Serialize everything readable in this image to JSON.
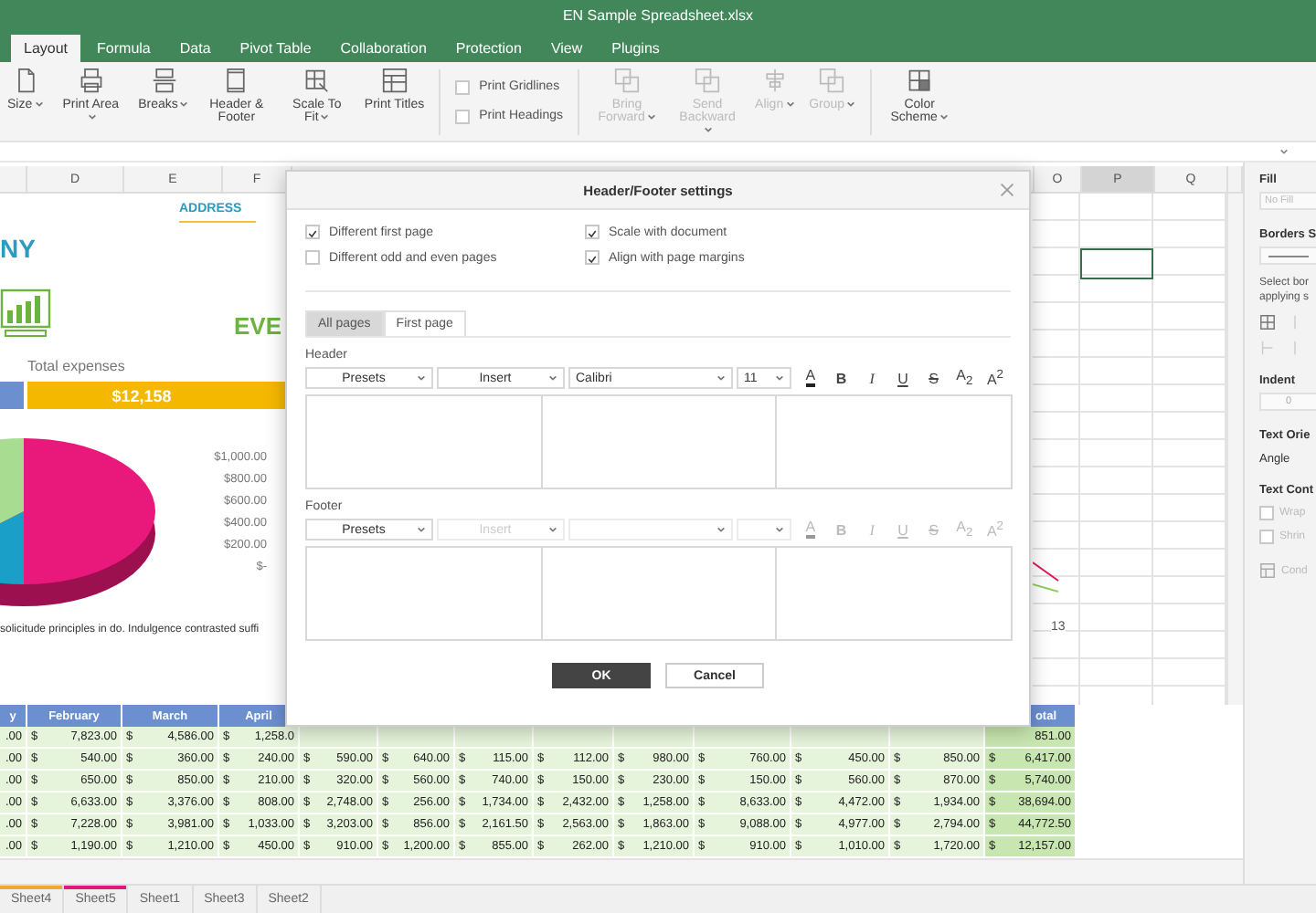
{
  "window": {
    "title": "EN Sample Spreadsheet.xlsx"
  },
  "tabs": [
    {
      "label": "Layout",
      "selected": true
    },
    {
      "label": "Formula",
      "selected": false
    },
    {
      "label": "Data",
      "selected": false
    },
    {
      "label": "Pivot Table",
      "selected": false
    },
    {
      "label": "Collaboration",
      "selected": false
    },
    {
      "label": "Protection",
      "selected": false
    },
    {
      "label": "View",
      "selected": false
    },
    {
      "label": "Plugins",
      "selected": false
    }
  ],
  "toolbar": {
    "page_buttons": [
      {
        "kind": "size",
        "label": "Size",
        "dropdown": true,
        "disabled": false
      },
      {
        "kind": "print-area",
        "label": "Print Area",
        "dropdown": true,
        "disabled": false
      },
      {
        "kind": "breaks",
        "label": "Breaks",
        "dropdown": true,
        "disabled": false
      },
      {
        "kind": "header-footer",
        "label": "Header & Footer",
        "dropdown": false,
        "disabled": false
      },
      {
        "kind": "scale",
        "label": "Scale To Fit",
        "dropdown": true,
        "disabled": false
      },
      {
        "kind": "print-titles",
        "label": "Print Titles",
        "dropdown": false,
        "disabled": false
      }
    ],
    "checkboxes": [
      {
        "label": "Print Gridlines",
        "checked": false
      },
      {
        "label": "Print Headings",
        "checked": false
      }
    ],
    "arrange_buttons": [
      {
        "kind": "bring-forward",
        "label": "Bring Forward",
        "dropdown": true,
        "disabled": true
      },
      {
        "kind": "send-backward",
        "label": "Send Backward",
        "dropdown": true,
        "disabled": true
      },
      {
        "kind": "align",
        "label": "Align",
        "dropdown": true,
        "disabled": true
      },
      {
        "kind": "group",
        "label": "Group",
        "dropdown": true,
        "disabled": true
      }
    ],
    "scheme_buttons": [
      {
        "kind": "color-scheme",
        "label": "Color Scheme",
        "dropdown": true,
        "disabled": false
      }
    ]
  },
  "sheet": {
    "columns_left": [
      {
        "label": "D",
        "selected": false
      },
      {
        "label": "E",
        "selected": false
      },
      {
        "label": "F",
        "selected": false
      }
    ],
    "columns_right": [
      {
        "label": "O",
        "selected": false
      },
      {
        "label": "P",
        "selected": true
      },
      {
        "label": "Q",
        "selected": false
      }
    ],
    "address_label": "ADDRESS",
    "company_fragment": "NY",
    "events_fragment": "EVE",
    "expenses_label": "Total expenses",
    "expenses_value": "$12,158",
    "axis_labels": [
      "$1,000.00",
      "$800.00",
      "$600.00",
      "$400.00",
      "$200.00",
      "$-"
    ],
    "note": "solicitude principles in do. Indulgence contrasted suffi",
    "chart_label": "13"
  },
  "table": {
    "headers": [
      "y",
      "February",
      "March",
      "April"
    ],
    "total_header": "otal",
    "rows": [
      [
        [
          ".00"
        ],
        [
          "$",
          "7,823.00"
        ],
        [
          "$",
          "4,586.00"
        ],
        [
          "$",
          "1,258.0"
        ],
        null,
        null,
        null,
        null,
        null,
        null,
        null,
        null,
        [
          "851.00"
        ]
      ],
      [
        [
          ".00"
        ],
        [
          "$",
          "540.00"
        ],
        [
          "$",
          "360.00"
        ],
        [
          "$",
          "240.00"
        ],
        [
          "$",
          "590.00"
        ],
        [
          "$",
          "640.00"
        ],
        [
          "$",
          "115.00"
        ],
        [
          "$",
          "112.00"
        ],
        [
          "$",
          "980.00"
        ],
        [
          "$",
          "760.00"
        ],
        [
          "$",
          "450.00"
        ],
        [
          "$",
          "850.00"
        ],
        [
          "$",
          "6,417.00"
        ]
      ],
      [
        [
          ".00"
        ],
        [
          "$",
          "650.00"
        ],
        [
          "$",
          "850.00"
        ],
        [
          "$",
          "210.00"
        ],
        [
          "$",
          "320.00"
        ],
        [
          "$",
          "560.00"
        ],
        [
          "$",
          "740.00"
        ],
        [
          "$",
          "150.00"
        ],
        [
          "$",
          "230.00"
        ],
        [
          "$",
          "150.00"
        ],
        [
          "$",
          "560.00"
        ],
        [
          "$",
          "870.00"
        ],
        [
          "$",
          "5,740.00"
        ]
      ],
      [
        [
          ".00"
        ],
        [
          "$",
          "6,633.00"
        ],
        [
          "$",
          "3,376.00"
        ],
        [
          "$",
          "808.00"
        ],
        [
          "$",
          "2,748.00"
        ],
        [
          "$",
          "256.00"
        ],
        [
          "$",
          "1,734.00"
        ],
        [
          "$",
          "2,432.00"
        ],
        [
          "$",
          "1,258.00"
        ],
        [
          "$",
          "8,633.00"
        ],
        [
          "$",
          "4,472.00"
        ],
        [
          "$",
          "1,934.00"
        ],
        [
          "$",
          "38,694.00"
        ]
      ],
      [
        [
          ".00"
        ],
        [
          "$",
          "7,228.00"
        ],
        [
          "$",
          "3,981.00"
        ],
        [
          "$",
          "1,033.00"
        ],
        [
          "$",
          "3,203.00"
        ],
        [
          "$",
          "856.00"
        ],
        [
          "$",
          "2,161.50"
        ],
        [
          "$",
          "2,563.00"
        ],
        [
          "$",
          "1,863.00"
        ],
        [
          "$",
          "9,088.00"
        ],
        [
          "$",
          "4,977.00"
        ],
        [
          "$",
          "2,794.00"
        ],
        [
          "$",
          "44,772.50"
        ]
      ],
      [
        [
          ".00"
        ],
        [
          "$",
          "1,190.00"
        ],
        [
          "$",
          "1,210.00"
        ],
        [
          "$",
          "450.00"
        ],
        [
          "$",
          "910.00"
        ],
        [
          "$",
          "1,200.00"
        ],
        [
          "$",
          "855.00"
        ],
        [
          "$",
          "262.00"
        ],
        [
          "$",
          "1,210.00"
        ],
        [
          "$",
          "910.00"
        ],
        [
          "$",
          "1,010.00"
        ],
        [
          "$",
          "1,720.00"
        ],
        [
          "$",
          "12,157.00"
        ]
      ]
    ]
  },
  "sheet_tabs": [
    {
      "label": "Sheet4",
      "color": "#f0a830"
    },
    {
      "label": "Sheet5",
      "color": "#e0197a"
    },
    {
      "label": "Sheet1"
    },
    {
      "label": "Sheet3"
    },
    {
      "label": "Sheet2"
    }
  ],
  "panel": {
    "fill_label": "Fill",
    "fill_placeholder": "No Fill",
    "borders_label": "Borders S",
    "borders_hint": [
      "Select bor",
      "applying s"
    ],
    "indent_label": "Indent",
    "indent_value": "0",
    "orientation_label": "Text Orie",
    "angle_label": "Angle",
    "control_label": "Text Cont",
    "options": [
      {
        "label": "Wrap",
        "checked": false,
        "disabled": true
      },
      {
        "label": "Shrin",
        "checked": false,
        "disabled": true
      }
    ],
    "conditional": {
      "label": "Cond",
      "disabled": true
    }
  },
  "dialog": {
    "title": "Header/Footer settings",
    "options": [
      {
        "label": "Different first page",
        "checked": true
      },
      {
        "label": "Scale with document",
        "checked": true
      },
      {
        "label": "Different odd and even pages",
        "checked": false
      },
      {
        "label": "Align with page margins",
        "checked": true
      }
    ],
    "tabs": [
      {
        "label": "All pages",
        "selected": true
      },
      {
        "label": "First page",
        "selected": false
      }
    ],
    "sections": [
      {
        "label": "Header",
        "presets": {
          "label": "Presets",
          "disabled": false
        },
        "insert": {
          "label": "Insert",
          "disabled": false
        },
        "font": {
          "value": "Calibri",
          "disabled": false
        },
        "size": {
          "value": "11",
          "disabled": false
        },
        "format_disabled": false,
        "format_buttons": [
          {
            "kind": "color",
            "label": "A"
          },
          {
            "kind": "bold",
            "label": "B"
          },
          {
            "kind": "italic",
            "label": "I"
          },
          {
            "kind": "underline",
            "label": "U"
          },
          {
            "kind": "strike",
            "label": "S"
          },
          {
            "kind": "subscript",
            "label": "A$_{2}$"
          },
          {
            "kind": "superscript",
            "label": "A$^{2}$"
          }
        ]
      },
      {
        "label": "Footer",
        "presets": {
          "label": "Presets",
          "disabled": false
        },
        "insert": {
          "label": "Insert",
          "disabled": true
        },
        "font": {
          "disabled": true
        },
        "size": {
          "disabled": true
        },
        "format_disabled": true,
        "format_buttons": [
          {
            "kind": "color",
            "label": "A"
          },
          {
            "kind": "bold",
            "label": "B"
          },
          {
            "kind": "italic",
            "label": "I"
          },
          {
            "kind": "underline",
            "label": "U"
          },
          {
            "kind": "strike",
            "label": "S"
          },
          {
            "kind": "subscript",
            "label": "A$_{2}$"
          },
          {
            "kind": "superscript",
            "label": "A$^{2}$"
          }
        ]
      }
    ],
    "buttons": [
      {
        "label": "OK",
        "kind": "primary"
      },
      {
        "label": "Cancel",
        "kind": "secondary"
      }
    ]
  }
}
